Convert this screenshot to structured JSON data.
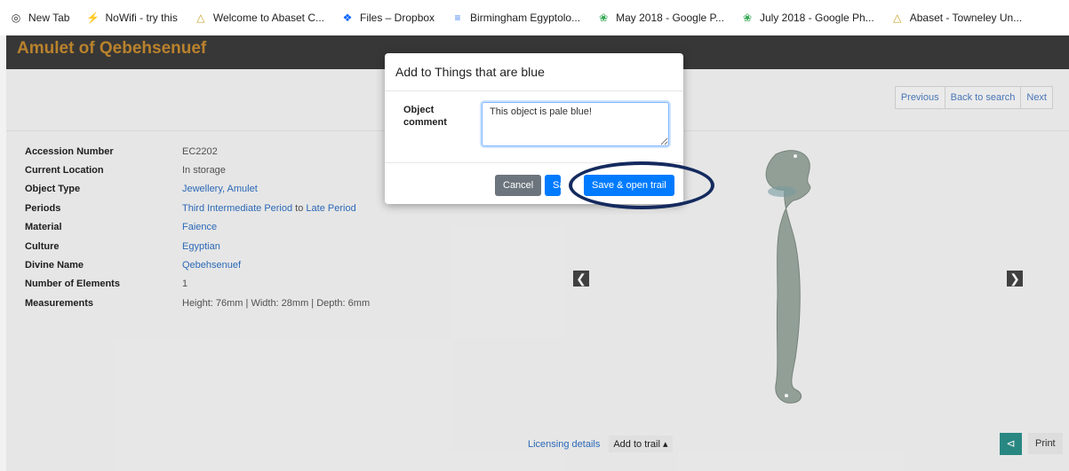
{
  "bookmarks": [
    {
      "label": "New Tab",
      "icon": "globe-icon",
      "color": "#333333"
    },
    {
      "label": "NoWifi - try this",
      "icon": "bolt-icon",
      "color": "#f2b400"
    },
    {
      "label": "Welcome to Abaset C...",
      "icon": "abaset-icon",
      "color": "#c9a227"
    },
    {
      "label": "Files – Dropbox",
      "icon": "dropbox-icon",
      "color": "#0061ff"
    },
    {
      "label": "Birmingham Egyptolo...",
      "icon": "docs-icon",
      "color": "#4285f4"
    },
    {
      "label": "May 2018 - Google P...",
      "icon": "photos-icon",
      "color": "#34a853"
    },
    {
      "label": "July 2018 - Google Ph...",
      "icon": "photos-icon",
      "color": "#34a853"
    },
    {
      "label": "Abaset - Towneley Un...",
      "icon": "abaset-icon",
      "color": "#c9a227"
    }
  ],
  "page_title": "Amulet of Qebehsenuef",
  "nav": {
    "previous": "Previous",
    "back": "Back to search",
    "next": "Next"
  },
  "details": [
    {
      "key": "Accession Number",
      "value": "EC2202"
    },
    {
      "key": "Current Location",
      "value": "In storage"
    },
    {
      "key": "Object Type",
      "value": "Jewellery, Amulet",
      "link": true
    },
    {
      "key": "Periods",
      "value_parts": [
        "Third Intermediate Period",
        " to ",
        "Late Period"
      ]
    },
    {
      "key": "Material",
      "value": "Faience",
      "link": true
    },
    {
      "key": "Culture",
      "value": "Egyptian",
      "link": true
    },
    {
      "key": "Divine Name",
      "value": "Qebehsenuef",
      "link": true
    },
    {
      "key": "Number of Elements",
      "value": "1"
    },
    {
      "key": "Measurements",
      "value": "Height: 76mm | Width: 28mm | Depth: 6mm"
    }
  ],
  "footer": {
    "licensing": "Licensing details",
    "add_to_trail": "Add to trail ▴",
    "print": "Print"
  },
  "modal": {
    "title": "Add to Things that are blue",
    "comment_label": "Object comment",
    "comment_value": "This object is pale blue!",
    "cancel": "Cancel",
    "save": "Sa",
    "save_open": "Save & open trail"
  },
  "colors": {
    "title_bar": "#3a3a3a",
    "title_text": "#c4892f",
    "link": "#2f6fc1",
    "primary": "#007bff",
    "ring": "#142a5e"
  }
}
